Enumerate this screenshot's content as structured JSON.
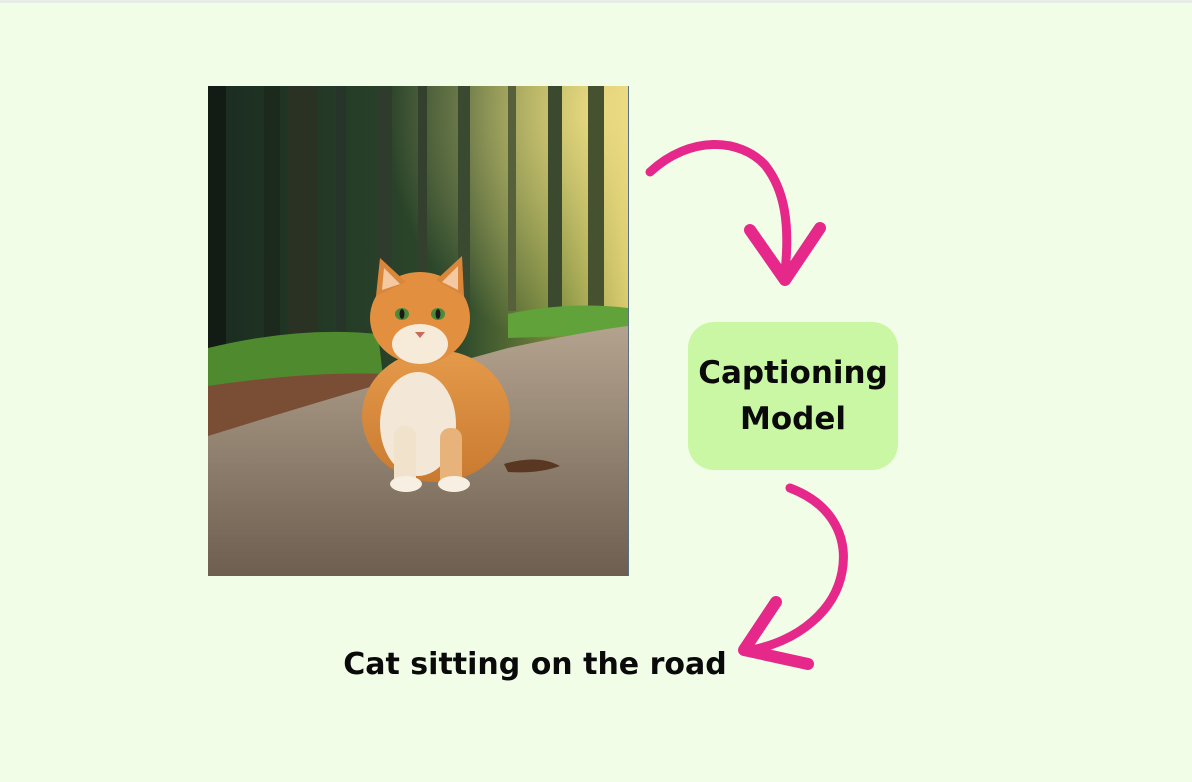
{
  "photo": {
    "subject": "cat-photo",
    "colors": {
      "forest_dark": "#1e2a1f",
      "foliage": "#4f8a2e",
      "road": "#8a7867",
      "cat_fur": "#d98a3c"
    }
  },
  "model": {
    "label": "Captioning Model"
  },
  "caption": {
    "text": "Cat sitting on the road"
  },
  "colors": {
    "background": "#f2fde8",
    "model_box": "#c9f7a4",
    "arrow": "#e5288a",
    "text": "#0a0a0a"
  }
}
